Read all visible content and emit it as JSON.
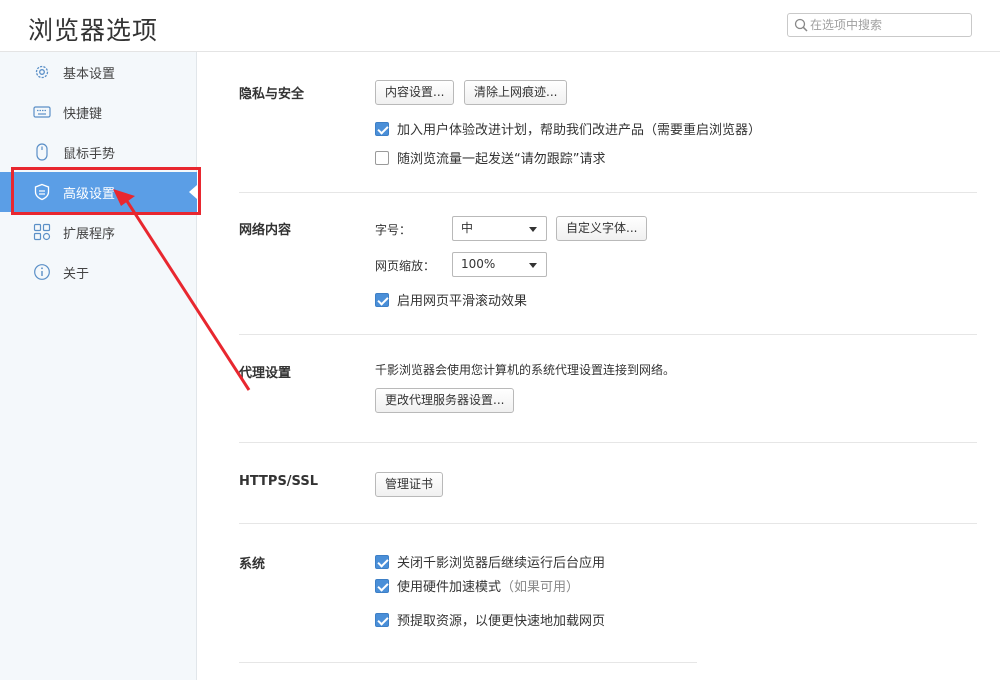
{
  "header": {
    "title": "浏览器选项",
    "search_placeholder": "在选项中搜索",
    "search_icon": "search-icon"
  },
  "sidebar": {
    "items": [
      {
        "label": "基本设置",
        "icon": "gear-icon"
      },
      {
        "label": "快捷键",
        "icon": "keyboard-icon"
      },
      {
        "label": "鼠标手势",
        "icon": "mouse-icon"
      },
      {
        "label": "高级设置",
        "icon": "shield-icon",
        "active": true
      },
      {
        "label": "扩展程序",
        "icon": "extensions-icon"
      },
      {
        "label": "关于",
        "icon": "info-icon"
      }
    ],
    "active_color": "#5b9ee6"
  },
  "annotation": {
    "color": "#e8272f"
  },
  "privacy": {
    "title": "隐私与安全",
    "content_settings_button": "内容设置...",
    "clear_history_button": "清除上网痕迹...",
    "join_program_label": "加入用户体验改进计划，帮助我们改进产品（需要重启浏览器）",
    "join_program_checked": true,
    "do_not_track_label": "随浏览流量一起发送“请勿跟踪”请求",
    "do_not_track_checked": false
  },
  "web_content": {
    "title": "网络内容",
    "font_size_label": "字号：",
    "font_size_value": "中",
    "custom_font_button": "自定义字体...",
    "page_zoom_label": "网页缩放：",
    "page_zoom_value": "100%",
    "smooth_scroll_label": "启用网页平滑滚动效果",
    "smooth_scroll_checked": true
  },
  "proxy": {
    "title": "代理设置",
    "description": "千影浏览器会使用您计算机的系统代理设置连接到网络。",
    "change_proxy_button": "更改代理服务器设置..."
  },
  "https": {
    "title": "HTTPS/SSL",
    "manage_certs_button": "管理证书"
  },
  "system": {
    "title": "系统",
    "background_apps_label": "关闭千影浏览器后继续运行后台应用",
    "background_apps_checked": true,
    "hw_accel_label": "使用硬件加速模式",
    "hw_accel_note": "（如果可用）",
    "hw_accel_checked": true,
    "prefetch_label": "预提取资源，以便更快速地加载网页",
    "prefetch_checked": true
  }
}
